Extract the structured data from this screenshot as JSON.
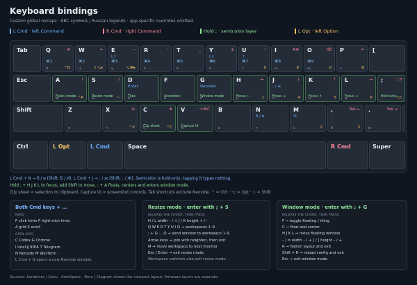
{
  "title": "Keyboard bindings",
  "subtitle": "Custom global remaps · ABC symbols / Russian legends · app-specific overrides omitted",
  "legend": [
    {
      "label": "L Cmd · left Command",
      "color": "#6ab0ff"
    },
    {
      "label": "R Cmd · right Command",
      "color": "#ff8a99"
    },
    {
      "label": "Hold ; · semicolon layer",
      "color": "#8fe39a"
    },
    {
      "label": "L Opt · left Option",
      "color": "#f2c464"
    }
  ],
  "keys": [
    {
      "id": "tab",
      "base": "Tab"
    },
    {
      "id": "q",
      "base": "Q",
      "rb": "⊗",
      "lc": "⌘1",
      "bl": "й",
      "or": "^Q"
    },
    {
      "id": "w",
      "base": "W",
      "rb": "+",
      "lc": "⌘2",
      "bl": "ц",
      "or": "⇧⌥▸"
    },
    {
      "id": "e",
      "base": "E",
      "rb": "–",
      "lb": "L⇧",
      "lc": "⌘3",
      "bl": "у",
      "or": "⌥⌘▸"
    },
    {
      "id": "r",
      "base": "R",
      "rb": "'",
      "lc": "⌘4",
      "bl": "к"
    },
    {
      "id": "t",
      "base": "T",
      "rb": "_",
      "lc": "⌘5",
      "bl": "е"
    },
    {
      "id": "y",
      "base": "Y",
      "rb": "$",
      "lb": "L⇩",
      "lc": "⌘6",
      "bl": "н"
    },
    {
      "id": "u",
      "base": "U",
      "rb": "!",
      "lb": "↑",
      "lc": "⌘7",
      "bl": "г",
      "or": "0"
    },
    {
      "id": "i",
      "base": "I",
      "rb": "R⊗",
      "lc": "⌘8",
      "bl": "ш",
      "or": "9"
    },
    {
      "id": "o",
      "base": "O",
      "rb": "⌫",
      "lc": "⌘9",
      "bl": "щ",
      "or": "0"
    },
    {
      "id": "p",
      "base": "P",
      "rb": "=",
      "bl": "з",
      "or": "B"
    },
    {
      "id": "lbr",
      "base": "["
    },
    {
      "id": "esc",
      "base": "Esc"
    },
    {
      "id": "a",
      "base": "A",
      "rb": "(",
      "hd": "Float+mode",
      "bl": "ф",
      "or": "^A"
    },
    {
      "id": "s",
      "base": "S",
      "rb": ")",
      "hd": "Resize mode",
      "bl": "ы",
      "or": "~"
    },
    {
      "id": "d",
      "base": "D",
      "lb": "Enter",
      "hd": "Tiles",
      "bl": "в"
    },
    {
      "id": "f",
      "base": "F",
      "hd": "Accordion",
      "bl": "а"
    },
    {
      "id": "g",
      "base": "G",
      "lb": "Neovide",
      "hd": "Window mode",
      "bl": "п"
    },
    {
      "id": "h",
      "base": "H",
      "rb": "←",
      "hd": "Focus ←",
      "bl": "р",
      "or": "1"
    },
    {
      "id": "j",
      "base": "J",
      "rb": "↓",
      "lb": "; / ж",
      "hd": "Focus ↓",
      "bl": "о",
      "or": "4"
    },
    {
      "id": "k",
      "base": "K",
      "rb": "↑",
      "hd": "Focus ↑",
      "bl": "л",
      "or": "5"
    },
    {
      "id": "l",
      "base": "L",
      "rb": "→",
      "hd": "Focus →",
      "bl": "д",
      "or": "6"
    },
    {
      "id": "semi",
      "base": ";",
      "rb": "' / Э",
      "hd": "Hold only",
      "or": "⌥\\"
    },
    {
      "id": "shift",
      "base": "Shift"
    },
    {
      "id": "z",
      "base": "Z",
      "bl": "я"
    },
    {
      "id": "x",
      "base": "X",
      "rb": "&",
      "bl": "ч",
      "or": "^X"
    },
    {
      "id": "c",
      "base": "C",
      "rb": "#",
      "hd": "Clip sheet",
      "bl": "с",
      "or": "^C"
    },
    {
      "id": "v",
      "base": "V",
      "rb": "⌥⌘C",
      "hd": "Capture UI",
      "bl": "м"
    },
    {
      "id": "b",
      "base": "B",
      "bl": "и"
    },
    {
      "id": "n",
      "base": "N",
      "lb": "б / и",
      "bl": "т"
    },
    {
      "id": "m",
      "base": "M",
      "lb": "%",
      "bl": "ь",
      "or": "2"
    },
    {
      "id": "comma",
      "base": ",",
      "rb": "Tab ←",
      "bl": "б",
      "or": "3"
    },
    {
      "id": "dot",
      "base": ".",
      "rb": "Tab →",
      "bl": "ю"
    },
    {
      "id": "slash",
      "base": "/",
      "rb": "\\",
      "lb": "? / ,",
      "bl": "."
    },
    {
      "id": "ctrl",
      "base": "Ctrl"
    },
    {
      "id": "lopt",
      "base": "L Opt"
    },
    {
      "id": "lcmd",
      "base": "L Cmd"
    },
    {
      "id": "space",
      "base": "Space"
    },
    {
      "id": "rcmd",
      "base": "R Cmd"
    },
    {
      "id": "super",
      "base": "Super"
    }
  ],
  "notes": {
    "line1": "L Cmd + N → б / и (Shift: Б / И). L Cmd + J → ; / ж (Shift: : / Ж). Semicolon is hold-only; tapping it types nothing.",
    "line2": "Hold ; + H J K L to focus; add Shift to move. ; + A floats, centers and enters window mode.",
    "line3": "Clip sheet = selection to clipboard. Capture UI = screenshot controls. Tab shortcuts exclude Neovide. ^ = Ctrl · ⌥ = Opt · ⇧ = Shift"
  },
  "panels": {
    "both_cmd": {
      "title": "Both Cmd keys + …",
      "sect1": "NERU",
      "l1": "F click hints  P right-click hints",
      "l2": "A grid  S scroll",
      "sect2": "OPEN APPS",
      "l3": "C Codex  G Chrome",
      "l4": "I IntelliJ IDEA  T Telegram",
      "l5": "N Neovide  M WezTerm",
      "l6": "L Cmd + G opens a new Neovide window."
    },
    "resize": {
      "title": "Resize mode · enter with ; + S",
      "sect1": "RELEASE THE CHORD, THEN PRESS",
      "l1": "H / L width – / +  J / K height + / –",
      "l2": "Q W E R T Y U I O → workspaces 1–9",
      "l3": "; + Q … O → send window to workspace 1–9",
      "l4": "Arrow keys → join with neighbor, then exit",
      "l5": "M → move workspace to next monitor",
      "l6": "Esc / Enter → exit resize mode",
      "l7": "Workspace switches also exit resize mode."
    },
    "window": {
      "title": "Window mode · enter with ; + G",
      "sect1": "RELEASE THE CHORD, THEN PRESS",
      "l1": "F → toggle floating / tiling",
      "l2": "C → float and center",
      "l3": "H J K L → move floating window",
      "l4": "– / = width – / +  [ / ] height – / +",
      "l5": "R → flatten layout and exit",
      "l6": "Shift + R → reload config and exit",
      "l7": "Esc → exit window mode"
    }
  },
  "sources": "Sources: Karabiner / Goku · AeroSpace · Neru | Diagram shows the compact layout; firmware layers are separate."
}
